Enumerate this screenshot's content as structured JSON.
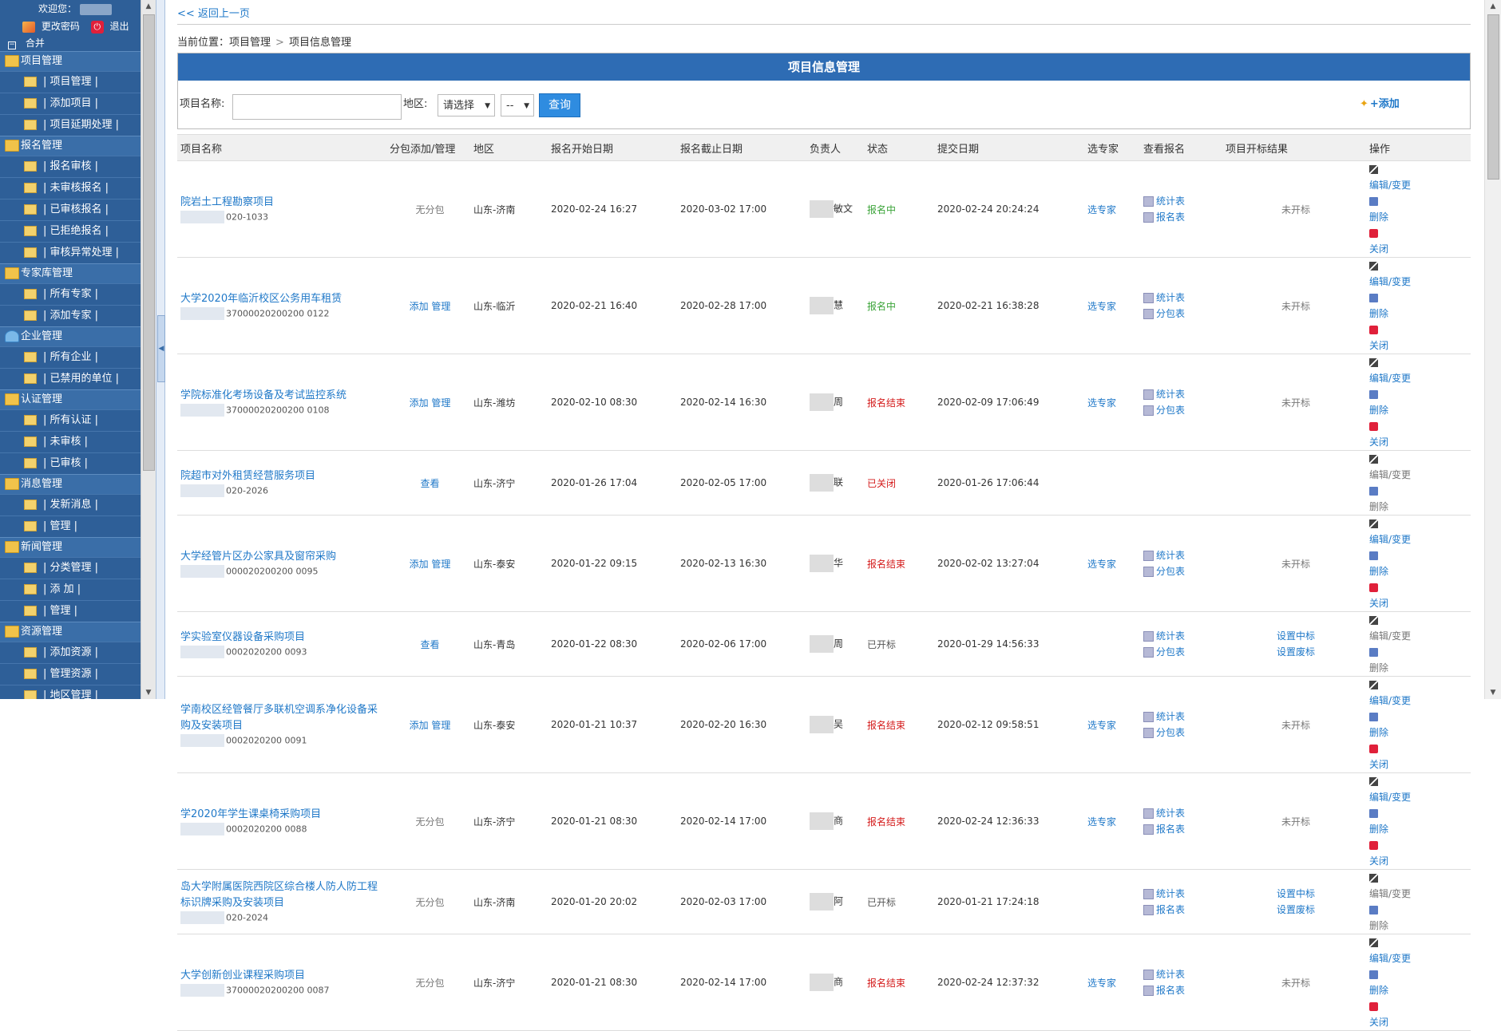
{
  "sidebar": {
    "welcome": "欢迎您：",
    "user_suffix": "s",
    "change_password": "更改密码",
    "logout": "退出",
    "merge": "合并",
    "groups": [
      {
        "title": "项目管理",
        "items": [
          "| 项目管理 |",
          "| 添加项目 |",
          "| 项目延期处理 |"
        ]
      },
      {
        "title": "报名管理",
        "items": [
          "| 报名审核 |",
          "| 未审核报名 |",
          "| 已审核报名 |",
          "| 已拒绝报名 |",
          "| 审核异常处理 |"
        ]
      },
      {
        "title": "专家库管理",
        "items": [
          "| 所有专家 |",
          "| 添加专家 |"
        ]
      },
      {
        "title": "企业管理",
        "items": [
          "| 所有企业 |",
          "| 已禁用的单位 |"
        ]
      },
      {
        "title": "认证管理",
        "items": [
          "| 所有认证 |",
          "| 未审核 |",
          "| 已审核 |"
        ]
      },
      {
        "title": "消息管理",
        "items": [
          "| 发新消息 |",
          "| 管理 |"
        ]
      },
      {
        "title": "新闻管理",
        "items": [
          "| 分类管理 |",
          "| 添 加 |",
          "| 管理 |"
        ]
      },
      {
        "title": "资源管理",
        "items": [
          "| 添加资源 |",
          "| 管理资源 |",
          "| 地区管理 |"
        ]
      }
    ]
  },
  "nav": {
    "back": "<< 返回上一页",
    "crumb_prefix": "当前位置：",
    "crumb_1": "项目管理",
    "crumb_sep": ">",
    "crumb_2": "项目信息管理"
  },
  "panel": {
    "title": "项目信息管理",
    "search": {
      "name_label": "项目名称:",
      "name_value": "",
      "region_label": "地区:",
      "region_select": "请选择",
      "region_sub": "--",
      "query_button": "查询",
      "add_link": "+添加"
    }
  },
  "table": {
    "headers": [
      "项目名称",
      "分包添加/管理",
      "地区",
      "报名开始日期",
      "报名截止日期",
      "负责人",
      "状态",
      "提交日期",
      "选专家",
      "查看报名",
      "项目开标结果",
      "操作"
    ],
    "rows": [
      {
        "name": "院岩土工程勘察项目",
        "code": "020-1033",
        "pkg": "无分包",
        "region": "山东-济南",
        "start": "2020-02-24 16:27",
        "end": "2020-03-02 17:00",
        "owner": "敏文",
        "status": "报名中",
        "status_class": "st-green",
        "submit": "2020-02-24 20:24:24",
        "expert": "选专家",
        "view1": "统计表",
        "view2": "报名表",
        "result": "未开标",
        "edit": "编辑/变更",
        "del": "删除",
        "close": "关闭",
        "short": false,
        "edit_dis": false
      },
      {
        "name": "大学2020年临沂校区公务用车租赁",
        "code": "37000020200200 0122",
        "pkg": "添加 管理",
        "region": "山东-临沂",
        "start": "2020-02-21 16:40",
        "end": "2020-02-28 17:00",
        "owner": "慧",
        "status": "报名中",
        "status_class": "st-green",
        "submit": "2020-02-21 16:38:28",
        "expert": "选专家",
        "view1": "统计表",
        "view2": "分包表",
        "result": "未开标",
        "edit": "编辑/变更",
        "del": "删除",
        "close": "关闭",
        "short": false,
        "edit_dis": false
      },
      {
        "name": "学院标准化考场设备及考试监控系统",
        "code": "37000020200200 0108",
        "pkg": "添加 管理",
        "region": "山东-潍坊",
        "start": "2020-02-10 08:30",
        "end": "2020-02-14 16:30",
        "owner": "周",
        "status": "报名结束",
        "status_class": "st-red",
        "submit": "2020-02-09 17:06:49",
        "expert": "选专家",
        "view1": "统计表",
        "view2": "分包表",
        "result": "未开标",
        "edit": "编辑/变更",
        "del": "删除",
        "close": "关闭",
        "short": false,
        "edit_dis": false
      },
      {
        "name": "院超市对外租赁经营服务项目",
        "code": "020-2026",
        "pkg": "查看",
        "region": "山东-济宁",
        "start": "2020-01-26 17:04",
        "end": "2020-02-05 17:00",
        "owner": "联",
        "status": "已关闭",
        "status_class": "st-red",
        "submit": "2020-01-26 17:06:44",
        "expert": "",
        "view1": "",
        "view2": "",
        "result": "",
        "edit": "编辑/变更",
        "del": "删除",
        "close": "",
        "short": true,
        "edit_dis": true
      },
      {
        "name": "大学经管片区办公家具及窗帘采购",
        "code": "000020200200 0095",
        "pkg": "添加 管理",
        "region": "山东-泰安",
        "start": "2020-01-22 09:15",
        "end": "2020-02-13 16:30",
        "owner": "华",
        "status": "报名结束",
        "status_class": "st-red",
        "submit": "2020-02-02 13:27:04",
        "expert": "选专家",
        "view1": "统计表",
        "view2": "分包表",
        "result": "未开标",
        "edit": "编辑/变更",
        "del": "删除",
        "close": "关闭",
        "short": false,
        "edit_dis": false
      },
      {
        "name": "学实验室仪器设备采购项目",
        "code": "0002020200 0093",
        "pkg": "查看",
        "region": "山东-青岛",
        "start": "2020-01-22 08:30",
        "end": "2020-02-06 17:00",
        "owner": "周",
        "status": "已开标",
        "status_class": "st-gray",
        "submit": "2020-01-29 14:56:33",
        "expert": "",
        "view1": "统计表",
        "view2": "分包表",
        "result": "设置中标|设置废标",
        "edit": "编辑/变更",
        "del": "删除",
        "close": "",
        "short": false,
        "edit_dis": true
      },
      {
        "name": "学南校区经管餐厅多联机空调系净化设备采购及安装项目",
        "code": "0002020200 0091",
        "pkg": "添加 管理",
        "region": "山东-泰安",
        "start": "2020-01-21 10:37",
        "end": "2020-02-20 16:30",
        "owner": "吴",
        "status": "报名结束",
        "status_class": "st-red",
        "submit": "2020-02-12 09:58:51",
        "expert": "选专家",
        "view1": "统计表",
        "view2": "分包表",
        "result": "未开标",
        "edit": "编辑/变更",
        "del": "删除",
        "close": "关闭",
        "short": false,
        "edit_dis": false
      },
      {
        "name": "学2020年学生课桌椅采购项目",
        "code": "0002020200 0088",
        "pkg": "无分包",
        "region": "山东-济宁",
        "start": "2020-01-21 08:30",
        "end": "2020-02-14 17:00",
        "owner": "商",
        "status": "报名结束",
        "status_class": "st-red",
        "submit": "2020-02-24 12:36:33",
        "expert": "选专家",
        "view1": "统计表",
        "view2": "报名表",
        "result": "未开标",
        "edit": "编辑/变更",
        "del": "删除",
        "close": "关闭",
        "short": false,
        "edit_dis": false
      },
      {
        "name": "岛大学附属医院西院区综合楼人防人防工程标识牌采购及安装项目",
        "code": "020-2024",
        "pkg": "无分包",
        "region": "山东-济南",
        "start": "2020-01-20 20:02",
        "end": "2020-02-03 17:00",
        "owner": "阿",
        "status": "已开标",
        "status_class": "st-gray",
        "submit": "2020-01-21 17:24:18",
        "expert": "",
        "view1": "统计表",
        "view2": "报名表",
        "result": "设置中标|设置废标",
        "edit": "编辑/变更",
        "del": "删除",
        "close": "",
        "short": false,
        "edit_dis": true
      },
      {
        "name": "大学创新创业课程采购项目",
        "code": "37000020200200 0087",
        "pkg": "无分包",
        "region": "山东-济宁",
        "start": "2020-01-21 08:30",
        "end": "2020-02-14 17:00",
        "owner": "商",
        "status": "报名结束",
        "status_class": "st-red",
        "submit": "2020-02-24 12:37:32",
        "expert": "选专家",
        "view1": "统计表",
        "view2": "报名表",
        "result": "未开标",
        "edit": "编辑/变更",
        "del": "删除",
        "close": "关闭",
        "short": false,
        "edit_dis": false
      }
    ]
  },
  "colors": {
    "sidebar_bg": "#2e5f98",
    "title_bar": "#2e6cb4",
    "link": "#1f78c8",
    "status_active": "#3aa338",
    "status_ended": "#d41a1a"
  }
}
